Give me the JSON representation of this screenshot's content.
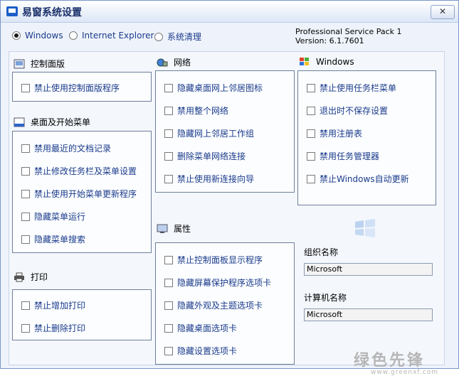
{
  "window": {
    "title": "易窗系统设置"
  },
  "radios": [
    {
      "label": "Windows",
      "selected": true
    },
    {
      "label": "Internet Explorer",
      "selected": false
    },
    {
      "label": "系统清理",
      "selected": false
    }
  ],
  "version": {
    "line1": "Professional Service Pack 1",
    "line2": "Version: 6.1.7601"
  },
  "sections": {
    "control_panel": {
      "title": "控制面版",
      "items": [
        "禁止使用控制面版程序"
      ]
    },
    "start_menu": {
      "title": "桌面及开始菜单",
      "items": [
        "禁用最近的文档记录",
        "禁止修改任务栏及菜单设置",
        "禁止使用开始菜单更新程序",
        "隐藏菜单运行",
        "隐藏菜单搜索"
      ]
    },
    "print": {
      "title": "打印",
      "items": [
        "禁止增加打印",
        "禁止删除打印"
      ]
    },
    "network": {
      "title": "网络",
      "items": [
        "隐藏桌面网上邻居图标",
        "禁用整个网络",
        "隐藏网上邻居工作组",
        "删除菜单网络连接",
        "禁止使用新连接向导"
      ]
    },
    "properties": {
      "title": "属性",
      "items": [
        "禁止控制面板显示程序",
        "隐藏屏幕保护程序选项卡",
        "隐藏外观及主题选项卡",
        "隐藏桌面选项卡",
        "隐藏设置选项卡"
      ]
    },
    "windows": {
      "title": "Windows",
      "items": [
        "禁止使用任务栏菜单",
        "退出时不保存设置",
        "禁用注册表",
        "禁用任务管理器",
        "禁止Windows自动更新"
      ]
    }
  },
  "fields": {
    "org_label": "组织名称",
    "org_value": "Microsoft",
    "computer_label": "计算机名称",
    "computer_value": "Microsoft"
  },
  "watermark": {
    "text": "绿色先锋",
    "url": "www.greenxf.com"
  }
}
